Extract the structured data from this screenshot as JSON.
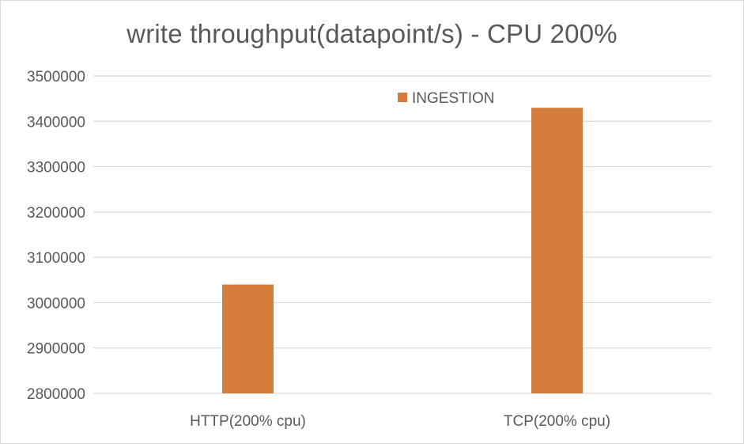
{
  "chart_data": {
    "type": "bar",
    "title": "write throughput(datapoint/s) - CPU 200%",
    "xlabel": "",
    "ylabel": "",
    "categories": [
      "HTTP(200% cpu)",
      "TCP(200% cpu)"
    ],
    "series": [
      {
        "name": "INGESTION",
        "color": "#d57d3c",
        "values": [
          3040000,
          3430000
        ]
      }
    ],
    "ylim": [
      2800000,
      3500000
    ],
    "yticks": [
      2800000,
      2900000,
      3000000,
      3100000,
      3200000,
      3300000,
      3400000,
      3500000
    ],
    "ytick_labels": [
      "2800000",
      "2900000",
      "3000000",
      "3100000",
      "3200000",
      "3300000",
      "3400000",
      "3500000"
    ],
    "grid": true,
    "legend_position": "top"
  },
  "colors": {
    "gridline": "#d9d9d9",
    "text": "#595959",
    "bar": "#d57d3c"
  }
}
